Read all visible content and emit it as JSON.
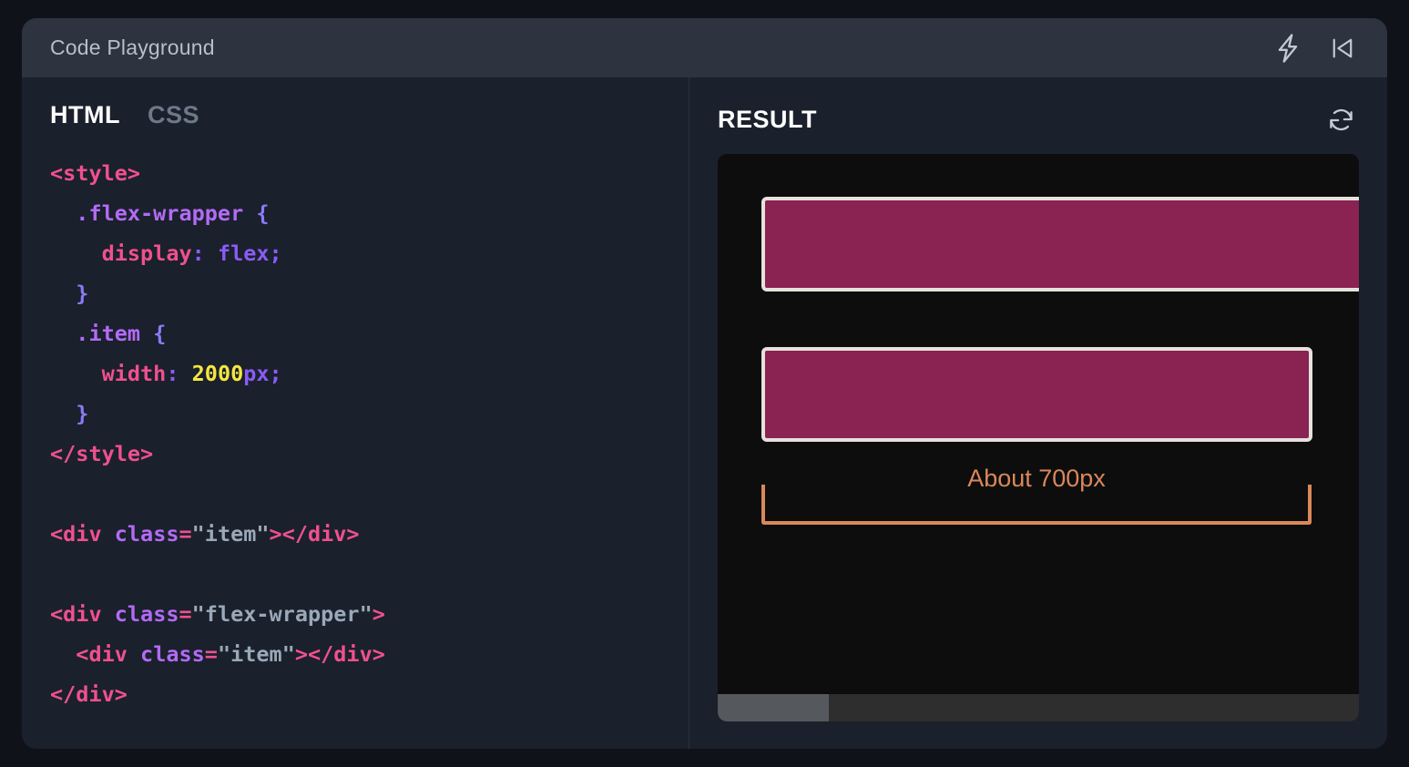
{
  "window": {
    "title": "Code Playground"
  },
  "titlebar": {
    "icons": [
      {
        "name": "lightning-bolt-icon",
        "label": "Run"
      },
      {
        "name": "skip-back-icon",
        "label": "Collapse panel"
      }
    ]
  },
  "editor": {
    "tabs": [
      {
        "label": "HTML",
        "active": true
      },
      {
        "label": "CSS",
        "active": false
      }
    ],
    "code_lines": [
      {
        "tokens": [
          {
            "t": "<style>",
            "c": "tag"
          }
        ]
      },
      {
        "tokens": [
          {
            "t": "  ",
            "c": "plain"
          },
          {
            "t": ".flex-wrapper",
            "c": "sel"
          },
          {
            "t": " ",
            "c": "plain"
          },
          {
            "t": "{",
            "c": "punc"
          }
        ]
      },
      {
        "tokens": [
          {
            "t": "    ",
            "c": "plain"
          },
          {
            "t": "display",
            "c": "prop"
          },
          {
            "t": ":",
            "c": "val"
          },
          {
            "t": " ",
            "c": "plain"
          },
          {
            "t": "flex;",
            "c": "val"
          }
        ]
      },
      {
        "tokens": [
          {
            "t": "  ",
            "c": "plain"
          },
          {
            "t": "}",
            "c": "punc"
          }
        ]
      },
      {
        "tokens": [
          {
            "t": "  ",
            "c": "plain"
          },
          {
            "t": ".item",
            "c": "sel"
          },
          {
            "t": " ",
            "c": "plain"
          },
          {
            "t": "{",
            "c": "punc"
          }
        ]
      },
      {
        "tokens": [
          {
            "t": "    ",
            "c": "plain"
          },
          {
            "t": "width",
            "c": "prop"
          },
          {
            "t": ":",
            "c": "val"
          },
          {
            "t": " ",
            "c": "plain"
          },
          {
            "t": "2000",
            "c": "num"
          },
          {
            "t": "px;",
            "c": "val"
          }
        ]
      },
      {
        "tokens": [
          {
            "t": "  ",
            "c": "plain"
          },
          {
            "t": "}",
            "c": "punc"
          }
        ]
      },
      {
        "tokens": [
          {
            "t": "</style>",
            "c": "tag"
          }
        ]
      },
      {
        "tokens": []
      },
      {
        "tokens": [
          {
            "t": "<div",
            "c": "tag"
          },
          {
            "t": " ",
            "c": "plain"
          },
          {
            "t": "class",
            "c": "attr"
          },
          {
            "t": "=",
            "c": "eq"
          },
          {
            "t": "\"item\"",
            "c": "str"
          },
          {
            "t": "></div>",
            "c": "tag"
          }
        ]
      },
      {
        "tokens": []
      },
      {
        "tokens": [
          {
            "t": "<div",
            "c": "tag"
          },
          {
            "t": " ",
            "c": "plain"
          },
          {
            "t": "class",
            "c": "attr"
          },
          {
            "t": "=",
            "c": "eq"
          },
          {
            "t": "\"flex-wrapper\"",
            "c": "str"
          },
          {
            "t": ">",
            "c": "tag"
          }
        ]
      },
      {
        "tokens": [
          {
            "t": "  ",
            "c": "plain"
          },
          {
            "t": "<div",
            "c": "tag"
          },
          {
            "t": " ",
            "c": "plain"
          },
          {
            "t": "class",
            "c": "attr"
          },
          {
            "t": "=",
            "c": "eq"
          },
          {
            "t": "\"item\"",
            "c": "str"
          },
          {
            "t": "></div>",
            "c": "tag"
          }
        ]
      },
      {
        "tokens": [
          {
            "t": "</div>",
            "c": "tag"
          }
        ]
      }
    ]
  },
  "result": {
    "title": "RESULT",
    "refresh_icon": "refresh-icon",
    "annotation": "About 700px",
    "boxes": [
      {
        "name": "item-box-standalone",
        "clipped": true
      },
      {
        "name": "item-box-in-flex-wrapper",
        "clipped": false
      }
    ],
    "scrollbar": {
      "name": "horizontal-scrollbar",
      "thumb_position": "left"
    }
  },
  "colors": {
    "window_bg": "#1a202c",
    "titlebar_bg": "#2d3440",
    "preview_bg": "#0d0d0d",
    "box_fill": "#8a2252",
    "box_border": "#e5e1dd",
    "annotation": "#d9885a",
    "tab_active": "#ffffff",
    "tab_inactive": "#6d7888"
  }
}
